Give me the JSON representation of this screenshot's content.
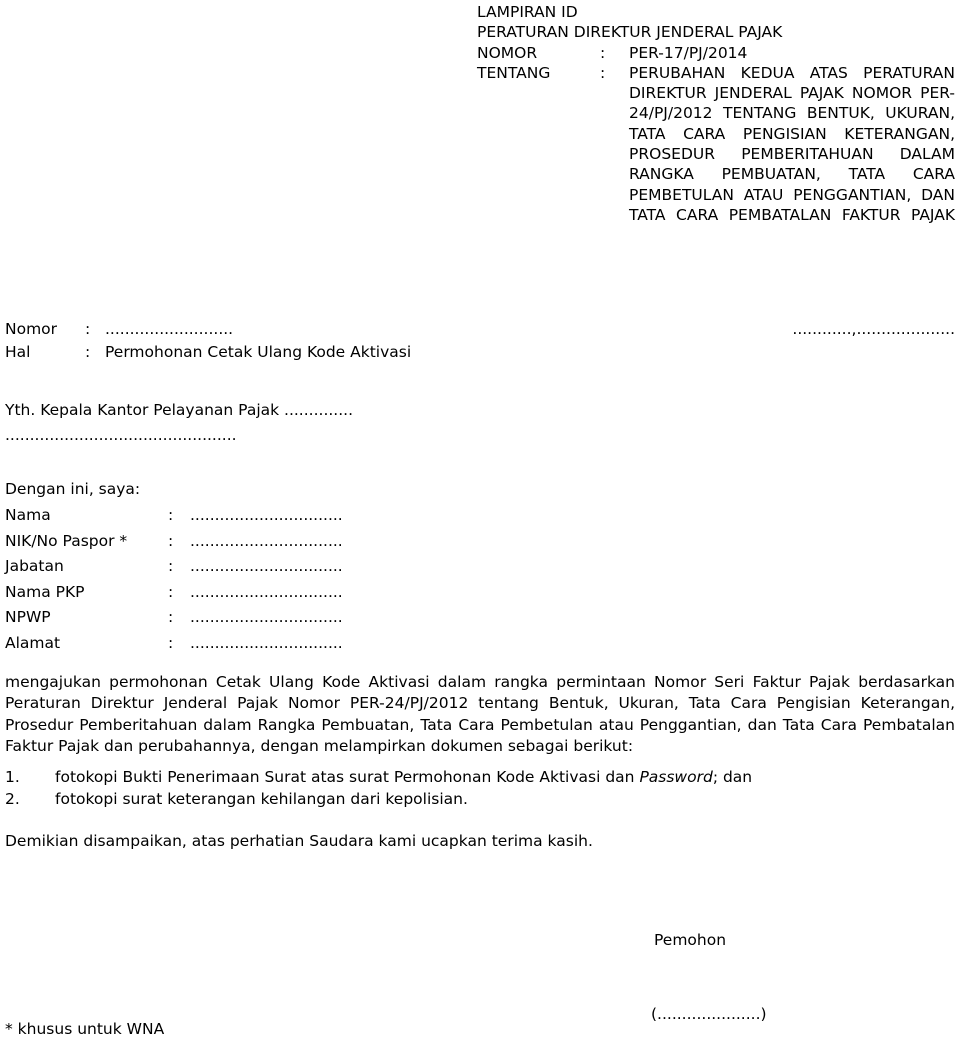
{
  "document": {
    "attachment_label": "LAMPIRAN ID",
    "regulation_title": "PERATURAN DIREKTUR JENDERAL PAJAK",
    "header_rows": [
      {
        "label": "NOMOR",
        "colon": ":",
        "value": "PER-17/PJ/2014",
        "justified": false
      },
      {
        "label": "TENTANG",
        "colon": ":",
        "value": "PERUBAHAN KEDUA ATAS PERATURAN DIREKTUR JENDERAL PAJAK NOMOR PER-24/PJ/2012 TENTANG BENTUK, UKURAN, TATA CARA PENGISIAN KETERANGAN, PROSEDUR PEMBERITAHUAN DALAM RANGKA PEMBUATAN, TATA CARA PEMBETULAN ATAU PENGGANTIAN, DAN TATA CARA PEMBATALAN FAKTUR PAJAK",
        "justified": true
      }
    ]
  },
  "meta": {
    "nomor_label": "Nomor",
    "nomor_colon": ":",
    "nomor_value": "..........................",
    "hal_label": "Hal",
    "hal_colon": ":",
    "hal_value": "Permohonan Cetak Ulang Kode Aktivasi",
    "date_placeholder": "............,...................."
  },
  "recipient": {
    "line1": "Yth. Kepala Kantor Pelayanan Pajak ..............",
    "line2": "..............................................."
  },
  "applicant": {
    "intro": "Dengan ini, saya:",
    "fields": [
      {
        "label": "Nama",
        "colon": ":",
        "value": "..............................."
      },
      {
        "label": "NIK/No Paspor *",
        "colon": ":",
        "value": "..............................."
      },
      {
        "label": "Jabatan",
        "colon": ":",
        "value": "..............................."
      },
      {
        "label": "Nama PKP",
        "colon": ":",
        "value": "..............................."
      },
      {
        "label": "NPWP",
        "colon": ":",
        "value": "..............................."
      },
      {
        "label": "Alamat",
        "colon": ":",
        "value": "..............................."
      }
    ]
  },
  "body": {
    "paragraph": "mengajukan permohonan Cetak Ulang Kode Aktivasi dalam rangka permintaan Nomor Seri Faktur Pajak berdasarkan Peraturan Direktur Jenderal Pajak Nomor PER-24/PJ/2012 tentang Bentuk, Ukuran, Tata Cara Pengisian Keterangan, Prosedur Pemberitahuan dalam Rangka Pembuatan, Tata Cara Pembetulan atau Penggantian, dan Tata Cara Pembatalan Faktur Pajak dan perubahannya, dengan melampirkan dokumen sebagai berikut:",
    "list": [
      {
        "number": "1.",
        "text_before": "fotokopi Bukti Penerimaan Surat atas surat Permohonan Kode Aktivasi dan ",
        "text_italic": "Password",
        "text_after": "; dan"
      },
      {
        "number": "2.",
        "text_before": "fotokopi surat keterangan kehilangan dari kepolisian.",
        "text_italic": "",
        "text_after": ""
      }
    ],
    "closing": "Demikian disampaikan, atas perhatian Saudara kami ucapkan terima kasih."
  },
  "signature": {
    "label": "Pemohon",
    "name_line": "(.....................)"
  },
  "footnote": "* khusus untuk WNA"
}
